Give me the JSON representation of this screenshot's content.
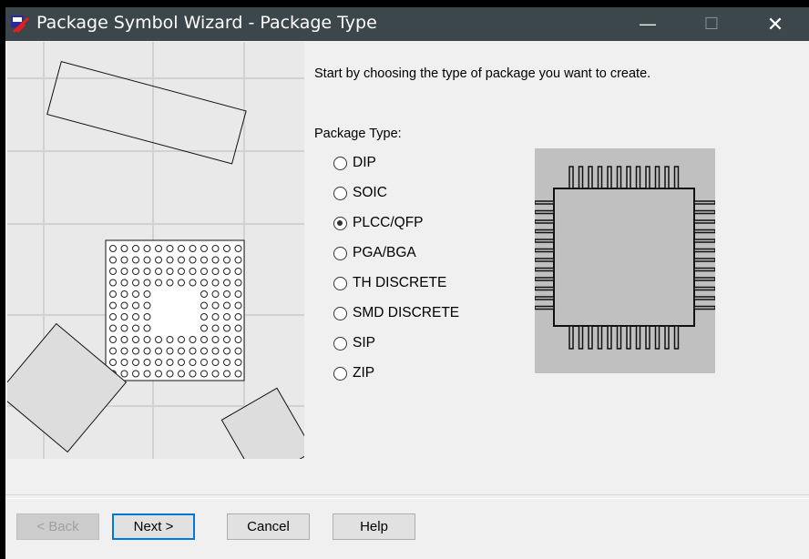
{
  "window": {
    "title": "Package Symbol Wizard - Package Type",
    "minimize_icon": "minimize-icon",
    "maximize_icon": "maximize-icon",
    "close_icon": "close-icon"
  },
  "main": {
    "intro": "Start by choosing the type of package you want to create.",
    "package_type_label": "Package Type:",
    "options": [
      {
        "label": "DIP",
        "selected": false
      },
      {
        "label": "SOIC",
        "selected": false
      },
      {
        "label": "PLCC/QFP",
        "selected": true
      },
      {
        "label": "PGA/BGA",
        "selected": false
      },
      {
        "label": "TH DISCRETE",
        "selected": false
      },
      {
        "label": "SMD DISCRETE",
        "selected": false
      },
      {
        "label": "SIP",
        "selected": false
      },
      {
        "label": "ZIP",
        "selected": false
      }
    ]
  },
  "buttons": {
    "back": "< Back",
    "next": "Next >",
    "cancel": "Cancel",
    "help": "Help"
  },
  "colors": {
    "titlebar": "#3c474c",
    "accent": "#0078d7",
    "background": "#f0f0f0"
  }
}
